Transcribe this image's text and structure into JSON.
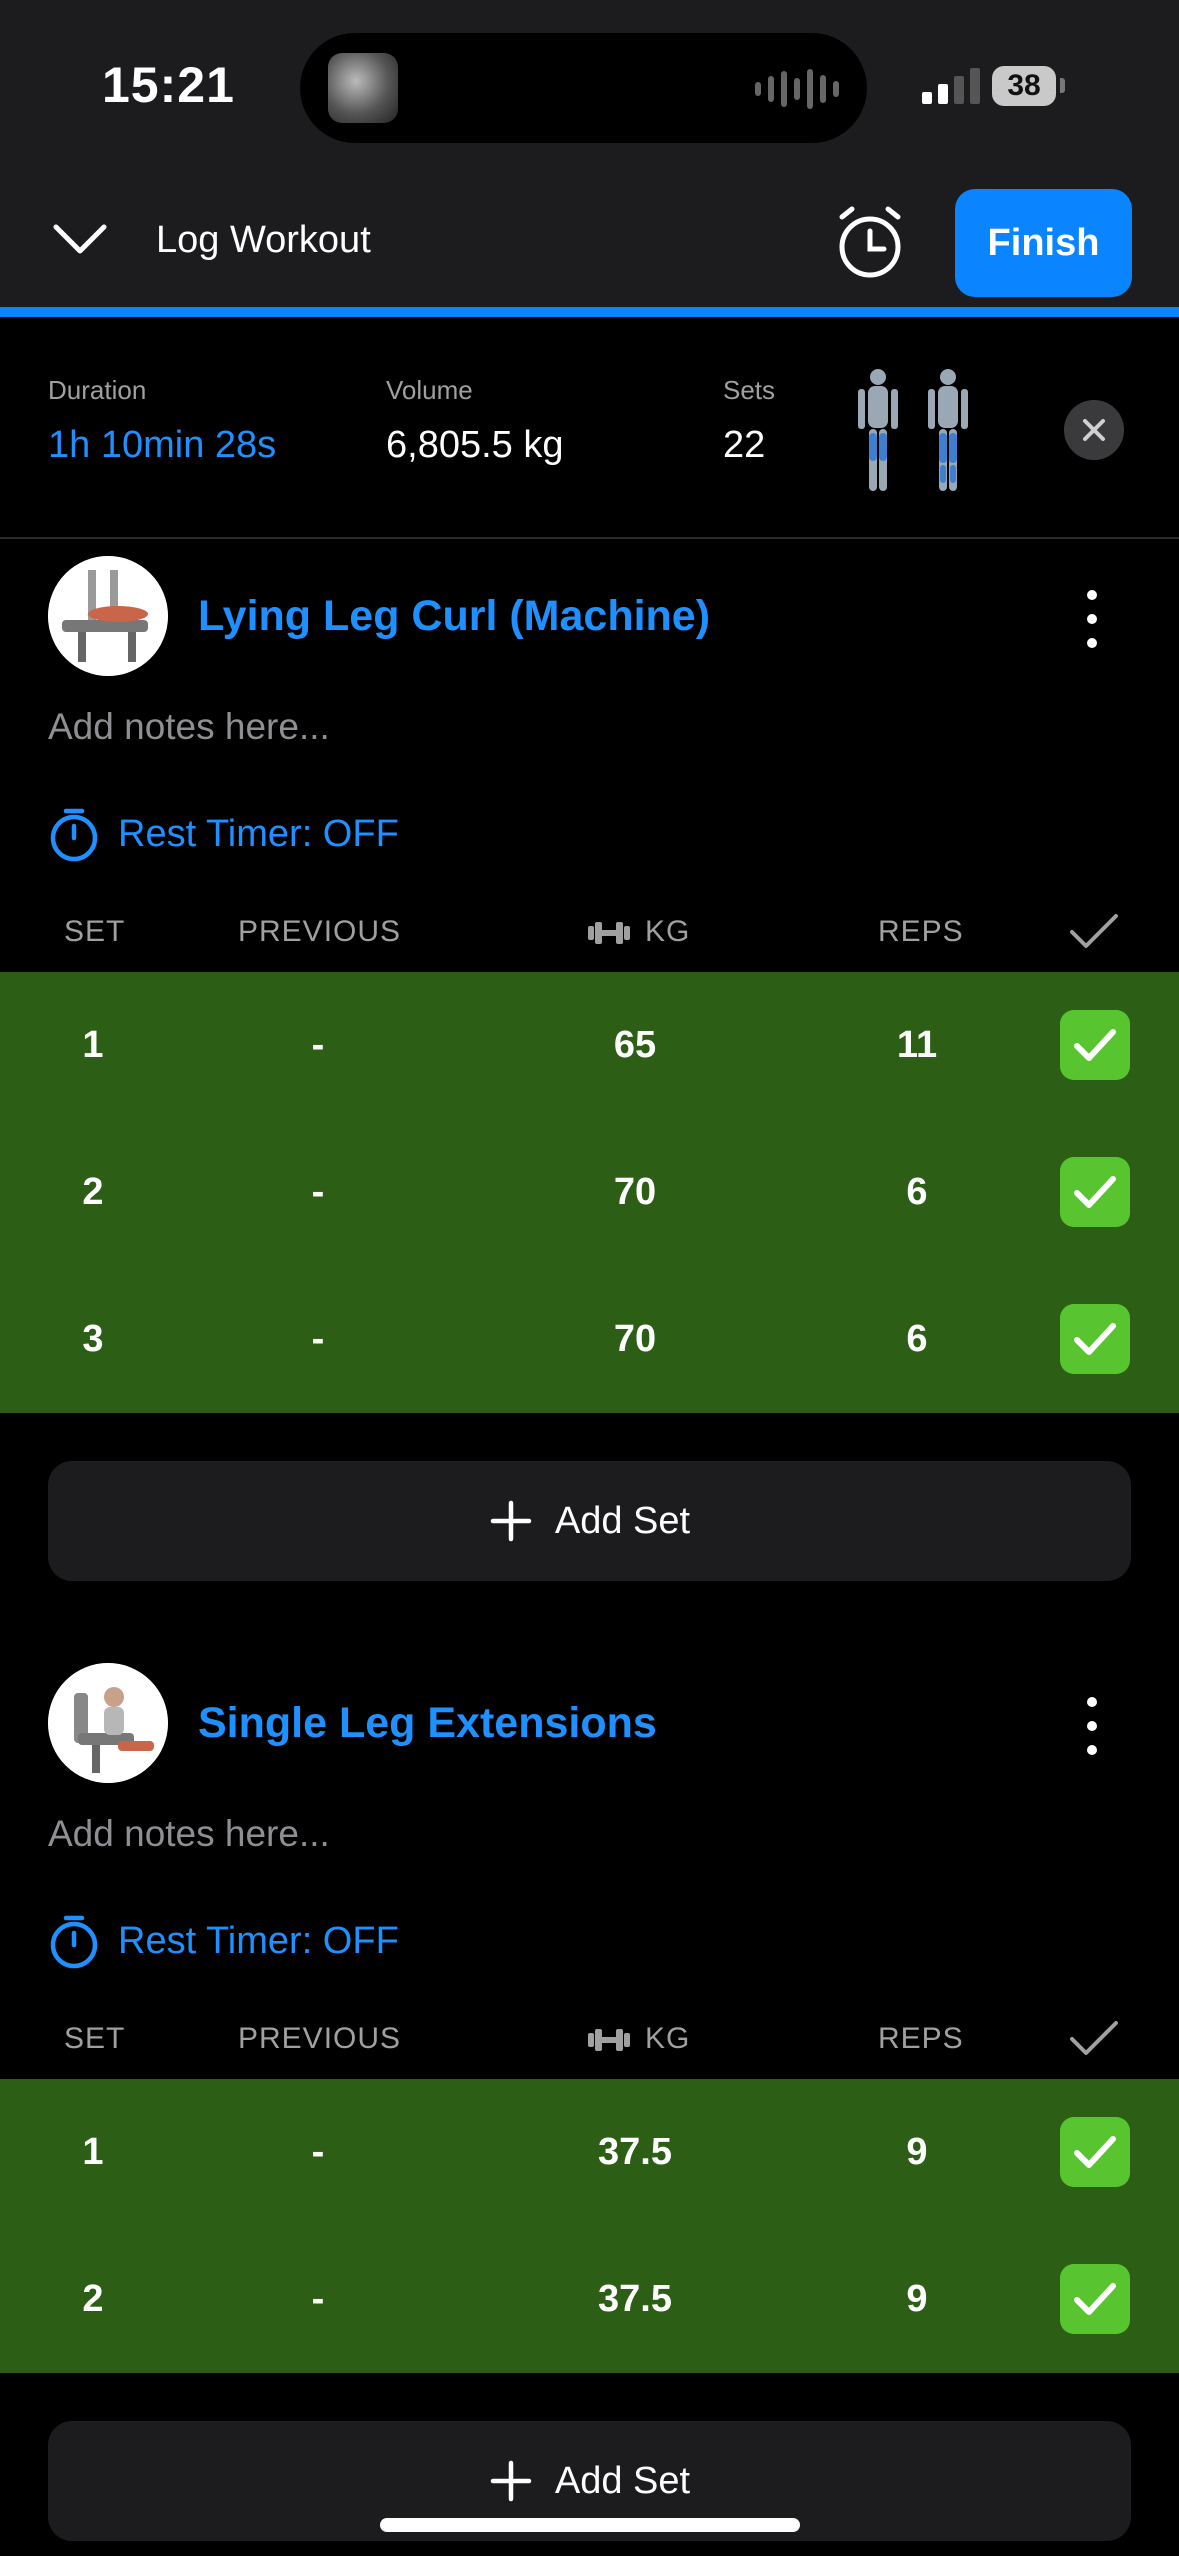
{
  "status_bar": {
    "time": "15:21",
    "battery": "38"
  },
  "header": {
    "title": "Log Workout",
    "finish_label": "Finish"
  },
  "summary": {
    "duration_label": "Duration",
    "duration_value": "1h 10min 28s",
    "volume_label": "Volume",
    "volume_value": "6,805.5 kg",
    "sets_label": "Sets",
    "sets_value": "22"
  },
  "columns": {
    "set": "SET",
    "previous": "PREVIOUS",
    "kg": "KG",
    "reps": "REPS"
  },
  "exercises": [
    {
      "name": "Lying Leg Curl (Machine)",
      "notes_placeholder": "Add notes here...",
      "rest_timer": "Rest Timer: OFF",
      "sets": [
        {
          "set": "1",
          "previous": "-",
          "kg": "65",
          "reps": "11",
          "done": true
        },
        {
          "set": "2",
          "previous": "-",
          "kg": "70",
          "reps": "6",
          "done": true
        },
        {
          "set": "3",
          "previous": "-",
          "kg": "70",
          "reps": "6",
          "done": true
        }
      ],
      "add_set_label": "Add Set"
    },
    {
      "name": "Single Leg Extensions",
      "notes_placeholder": "Add notes here...",
      "rest_timer": "Rest Timer: OFF",
      "sets": [
        {
          "set": "1",
          "previous": "-",
          "kg": "37.5",
          "reps": "9",
          "done": true
        },
        {
          "set": "2",
          "previous": "-",
          "kg": "37.5",
          "reps": "9",
          "done": true
        }
      ],
      "add_set_label": "Add Set"
    }
  ],
  "colors": {
    "accent": "#0a84ff",
    "completed_row": "#2c5f15",
    "check": "#58c42f"
  }
}
